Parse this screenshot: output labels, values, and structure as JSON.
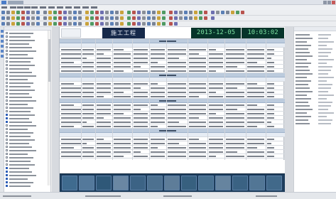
{
  "header": {
    "title": "施工工程",
    "date": "2013-12-05",
    "time": "10:03:02"
  },
  "colors": {
    "title_panel": "#16294a",
    "clock_panel": "#06342a",
    "clock_text": "#7be0a0",
    "section_row": "#bccbdd",
    "icon_strip": "#1d3d5c",
    "tree_selected_icon": "#2f5fb8"
  },
  "icons": {
    "app": "app-logo-icon",
    "tree_node": "folder-icon",
    "rail": "panel-icon",
    "strip": "equipment-thumbnail-icon"
  }
}
